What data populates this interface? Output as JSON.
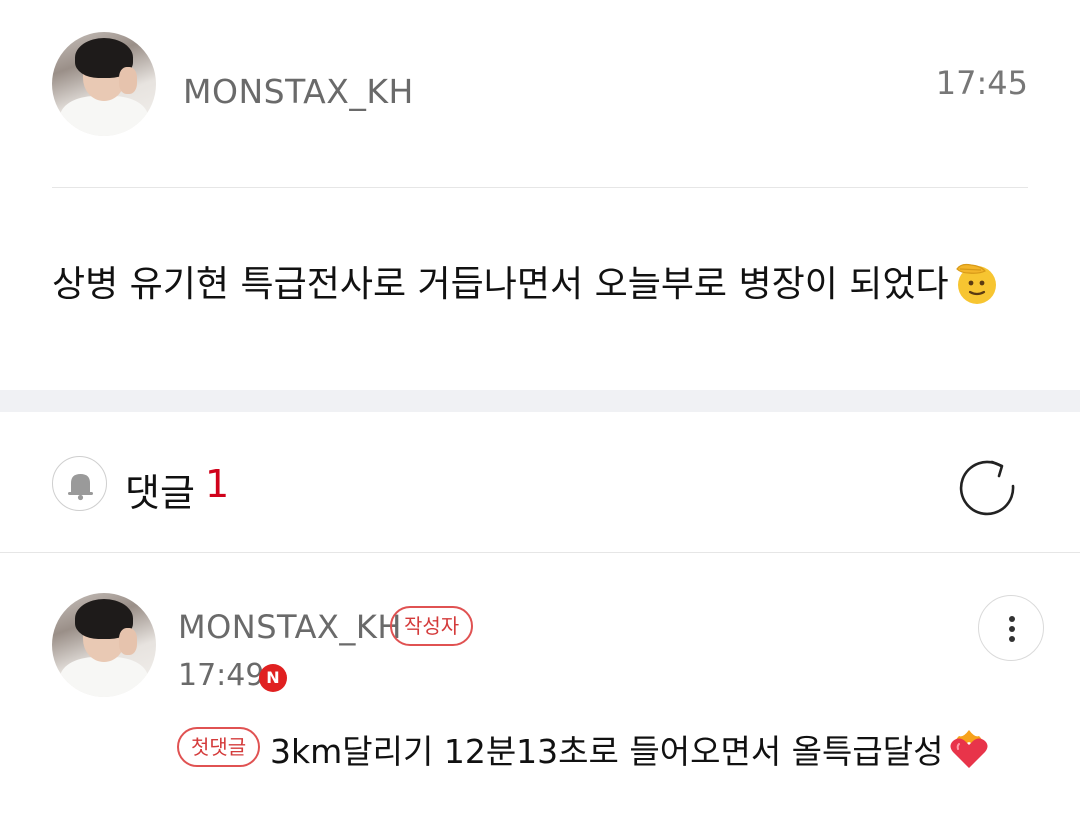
{
  "post": {
    "author": "MONSTAX_KH",
    "time": "17:45",
    "text": "상병 유기현 특급전사로 거듭나면서 오늘부로 병장이 되었다",
    "trailing_emoji": "saluting-face-icon"
  },
  "comments": {
    "label": "댓글",
    "count": "1",
    "bell_icon": "bell-icon",
    "refresh_icon": "refresh-icon",
    "items": [
      {
        "author": "MONSTAX_KH",
        "author_badge": "작성자",
        "time": "17:49",
        "new_badge": "N",
        "first_badge": "첫댓글",
        "text": "3km달리기 12분13초로 들어오면서 올특급달성",
        "trailing_emoji": "heart-on-fire-icon",
        "more_icon": "more-vertical-icon"
      }
    ]
  },
  "colors": {
    "accent_red": "#d0021b",
    "badge_red": "#e05252",
    "muted_text": "#6a6a6a",
    "section_gap": "#f0f1f4"
  }
}
